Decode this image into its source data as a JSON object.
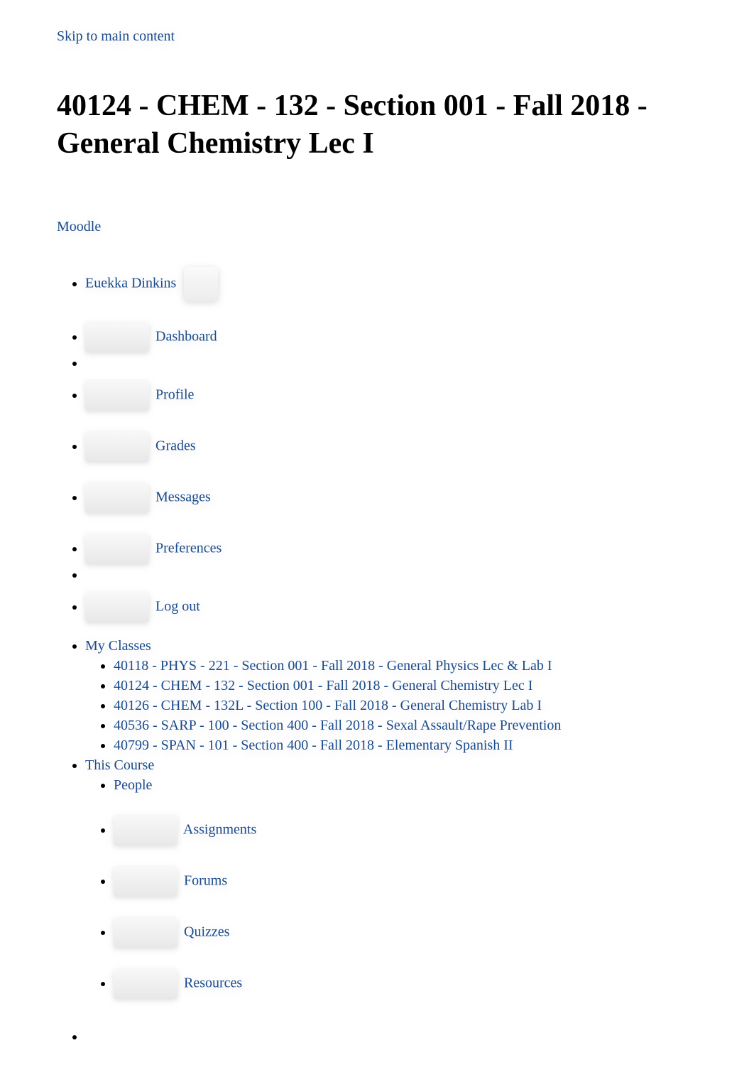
{
  "skip_link": "Skip to main content",
  "page_title": "40124 - CHEM - 132 - Section 001 - Fall 2018 - General Chemistry Lec I",
  "brand": "Moodle",
  "user_menu": {
    "username": "Euekka Dinkins",
    "items": [
      {
        "label": "Dashboard"
      },
      {
        "label": "Profile"
      },
      {
        "label": "Grades"
      },
      {
        "label": "Messages"
      },
      {
        "label": "Preferences"
      },
      {
        "label": "Log out"
      }
    ]
  },
  "nav": {
    "my_classes": {
      "label": "My Classes",
      "courses": [
        "40118 - PHYS - 221 - Section 001 - Fall 2018 - General Physics Lec & Lab I",
        "40124 - CHEM - 132 - Section 001 - Fall 2018 - General Chemistry Lec I",
        "40126 - CHEM - 132L - Section 100 - Fall 2018 - General Chemistry Lab I",
        "40536 - SARP - 100 - Section 400 - Fall 2018 - Sexal Assault/Rape Prevention",
        "40799 - SPAN - 101 - Section 400 - Fall 2018 - Elementary Spanish II"
      ]
    },
    "this_course": {
      "label": "This Course",
      "items": [
        {
          "label": "People"
        },
        {
          "label": "Assignments"
        },
        {
          "label": "Forums"
        },
        {
          "label": "Quizzes"
        },
        {
          "label": "Resources"
        }
      ]
    }
  }
}
